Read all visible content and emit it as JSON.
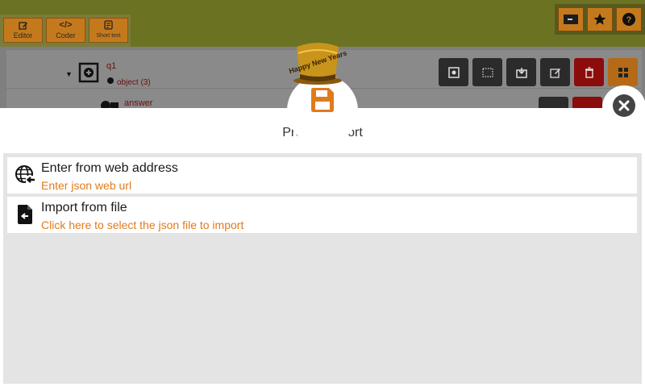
{
  "toolbar": {
    "tabs": [
      {
        "label": "Editor",
        "icon": "edit-icon"
      },
      {
        "label": "Coder",
        "icon": "code-icon"
      },
      {
        "label": "Short text",
        "icon": "note-icon"
      }
    ],
    "right_tools": [
      "flag-icon",
      "star-icon",
      "help-icon"
    ]
  },
  "tree": {
    "node1": {
      "name": "q1",
      "type": "object",
      "count": "(3)"
    },
    "node2": {
      "name": "answer"
    }
  },
  "decoration": {
    "hat_text": "Happy New Years"
  },
  "modal": {
    "title": "Project Import",
    "options": [
      {
        "title": "Enter from web address",
        "subtitle": "Enter json web url",
        "icon": "globe-import-icon"
      },
      {
        "title": "Import from file",
        "subtitle": "Click here to select the json file to import",
        "icon": "file-import-icon"
      }
    ]
  },
  "colors": {
    "topbar": "#6b7222",
    "tab": "#c47a1c",
    "accent_text": "#e07b1c",
    "danger": "#8c0c0c"
  }
}
